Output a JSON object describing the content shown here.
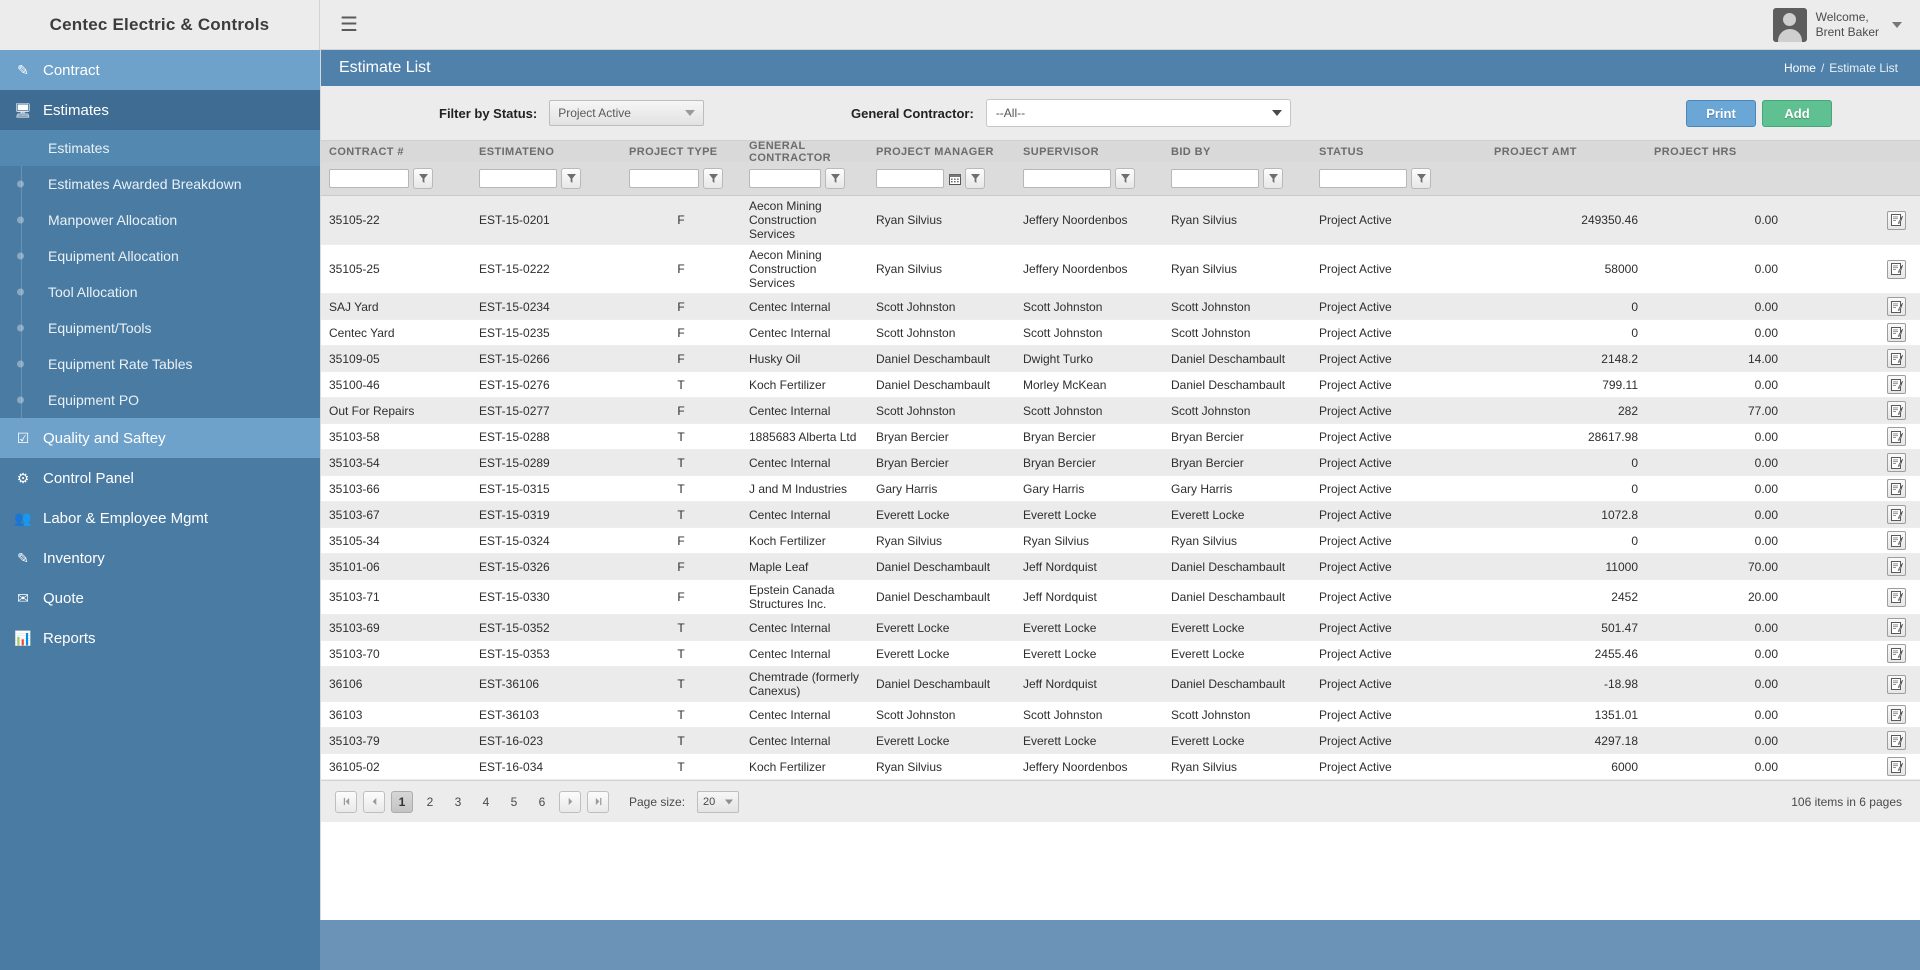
{
  "topbar": {
    "brand": "Centec Electric & Controls",
    "menu_icon": "hamburger-icon",
    "welcome_line1": "Welcome,",
    "welcome_line2": "Brent Baker"
  },
  "sidebar": {
    "items": [
      {
        "label": "Contract",
        "icon": "edit-square-icon",
        "state": "active-light"
      },
      {
        "label": "Estimates",
        "icon": "monitor-icon",
        "state": "active-dark"
      },
      {
        "label": "Quality and Saftey",
        "icon": "check-square-icon",
        "state": "active-light"
      },
      {
        "label": "Control Panel",
        "icon": "gears-icon",
        "state": "plain"
      },
      {
        "label": "Labor & Employee Mgmt",
        "icon": "users-icon",
        "state": "plain"
      },
      {
        "label": "Inventory",
        "icon": "edit-square-icon",
        "state": "plain"
      },
      {
        "label": "Quote",
        "icon": "envelope-icon",
        "state": "plain"
      },
      {
        "label": "Reports",
        "icon": "chart-icon",
        "state": "plain"
      }
    ],
    "estimates_children": [
      {
        "label": "Estimates",
        "selected": true
      },
      {
        "label": "Estimates Awarded Breakdown",
        "selected": false
      },
      {
        "label": "Manpower Allocation",
        "selected": false
      },
      {
        "label": "Equipment Allocation",
        "selected": false
      },
      {
        "label": "Tool Allocation",
        "selected": false
      },
      {
        "label": "Equipment/Tools",
        "selected": false
      },
      {
        "label": "Equipment Rate Tables",
        "selected": false
      },
      {
        "label": "Equipment PO",
        "selected": false
      }
    ]
  },
  "page": {
    "title": "Estimate List",
    "breadcrumb_home": "Home",
    "breadcrumb_sep": "/",
    "breadcrumb_current": "Estimate List"
  },
  "filters": {
    "status_label": "Filter by Status:",
    "status_value": "Project Active",
    "contractor_label": "General Contractor:",
    "contractor_value": "--All--",
    "print_label": "Print",
    "add_label": "Add"
  },
  "table": {
    "columns": [
      "CONTRACT #",
      "ESTIMATENO",
      "PROJECT TYPE",
      "GENERAL CONTRACTOR",
      "PROJECT MANAGER",
      "SUPERVISOR",
      "BID BY",
      "STATUS",
      "PROJECT AMT",
      "PROJECT HRS"
    ],
    "filter_values": [
      "",
      "",
      "",
      "",
      "",
      "",
      "",
      "",
      "",
      ""
    ],
    "rows": [
      {
        "contract": "35105-22",
        "estimateno": "EST-15-0201",
        "type": "F",
        "gc": "Aecon Mining Construction Services",
        "pm": "Ryan Silvius",
        "sup": "Jeffery Noordenbos",
        "bid": "Ryan Silvius",
        "status": "Project Active",
        "amt": "249350.46",
        "hrs": "0.00"
      },
      {
        "contract": "35105-25",
        "estimateno": "EST-15-0222",
        "type": "F",
        "gc": "Aecon Mining Construction Services",
        "pm": "Ryan Silvius",
        "sup": "Jeffery Noordenbos",
        "bid": "Ryan Silvius",
        "status": "Project Active",
        "amt": "58000",
        "hrs": "0.00"
      },
      {
        "contract": "SAJ Yard",
        "estimateno": "EST-15-0234",
        "type": "F",
        "gc": "Centec Internal",
        "pm": "Scott Johnston",
        "sup": "Scott Johnston",
        "bid": "Scott Johnston",
        "status": "Project Active",
        "amt": "0",
        "hrs": "0.00"
      },
      {
        "contract": "Centec Yard",
        "estimateno": "EST-15-0235",
        "type": "F",
        "gc": "Centec Internal",
        "pm": "Scott Johnston",
        "sup": "Scott Johnston",
        "bid": "Scott Johnston",
        "status": "Project Active",
        "amt": "0",
        "hrs": "0.00"
      },
      {
        "contract": "35109-05",
        "estimateno": "EST-15-0266",
        "type": "F",
        "gc": "Husky Oil",
        "pm": "Daniel Deschambault",
        "sup": "Dwight Turko",
        "bid": "Daniel Deschambault",
        "status": "Project Active",
        "amt": "2148.2",
        "hrs": "14.00"
      },
      {
        "contract": "35100-46",
        "estimateno": "EST-15-0276",
        "type": "T",
        "gc": "Koch Fertilizer",
        "pm": "Daniel Deschambault",
        "sup": "Morley McKean",
        "bid": "Daniel Deschambault",
        "status": "Project Active",
        "amt": "799.11",
        "hrs": "0.00"
      },
      {
        "contract": "Out For Repairs",
        "estimateno": "EST-15-0277",
        "type": "F",
        "gc": "Centec Internal",
        "pm": "Scott Johnston",
        "sup": "Scott Johnston",
        "bid": "Scott Johnston",
        "status": "Project Active",
        "amt": "282",
        "hrs": "77.00"
      },
      {
        "contract": "35103-58",
        "estimateno": "EST-15-0288",
        "type": "T",
        "gc": "1885683 Alberta Ltd",
        "pm": "Bryan Bercier",
        "sup": "Bryan Bercier",
        "bid": "Bryan Bercier",
        "status": "Project Active",
        "amt": "28617.98",
        "hrs": "0.00"
      },
      {
        "contract": "35103-54",
        "estimateno": "EST-15-0289",
        "type": "T",
        "gc": "Centec Internal",
        "pm": "Bryan Bercier",
        "sup": "Bryan Bercier",
        "bid": "Bryan Bercier",
        "status": "Project Active",
        "amt": "0",
        "hrs": "0.00"
      },
      {
        "contract": "35103-66",
        "estimateno": "EST-15-0315",
        "type": "T",
        "gc": "J and M Industries",
        "pm": "Gary Harris",
        "sup": "Gary Harris",
        "bid": "Gary Harris",
        "status": "Project Active",
        "amt": "0",
        "hrs": "0.00"
      },
      {
        "contract": "35103-67",
        "estimateno": "EST-15-0319",
        "type": "T",
        "gc": "Centec Internal",
        "pm": "Everett Locke",
        "sup": "Everett Locke",
        "bid": "Everett Locke",
        "status": "Project Active",
        "amt": "1072.8",
        "hrs": "0.00"
      },
      {
        "contract": "35105-34",
        "estimateno": "EST-15-0324",
        "type": "F",
        "gc": "Koch Fertilizer",
        "pm": "Ryan Silvius",
        "sup": "Ryan Silvius",
        "bid": "Ryan Silvius",
        "status": "Project Active",
        "amt": "0",
        "hrs": "0.00"
      },
      {
        "contract": "35101-06",
        "estimateno": "EST-15-0326",
        "type": "F",
        "gc": "Maple Leaf",
        "pm": "Daniel Deschambault",
        "sup": "Jeff Nordquist",
        "bid": "Daniel Deschambault",
        "status": "Project Active",
        "amt": "11000",
        "hrs": "70.00"
      },
      {
        "contract": "35103-71",
        "estimateno": "EST-15-0330",
        "type": "F",
        "gc": "Epstein Canada Structures Inc.",
        "pm": "Daniel Deschambault",
        "sup": "Jeff Nordquist",
        "bid": "Daniel Deschambault",
        "status": "Project Active",
        "amt": "2452",
        "hrs": "20.00"
      },
      {
        "contract": "35103-69",
        "estimateno": "EST-15-0352",
        "type": "T",
        "gc": "Centec Internal",
        "pm": "Everett Locke",
        "sup": "Everett Locke",
        "bid": "Everett Locke",
        "status": "Project Active",
        "amt": "501.47",
        "hrs": "0.00"
      },
      {
        "contract": "35103-70",
        "estimateno": "EST-15-0353",
        "type": "T",
        "gc": "Centec Internal",
        "pm": "Everett Locke",
        "sup": "Everett Locke",
        "bid": "Everett Locke",
        "status": "Project Active",
        "amt": "2455.46",
        "hrs": "0.00"
      },
      {
        "contract": "36106",
        "estimateno": "EST-36106",
        "type": "T",
        "gc": "Chemtrade (formerly Canexus)",
        "pm": "Daniel Deschambault",
        "sup": "Jeff Nordquist",
        "bid": "Daniel Deschambault",
        "status": "Project Active",
        "amt": "-18.98",
        "hrs": "0.00"
      },
      {
        "contract": "36103",
        "estimateno": "EST-36103",
        "type": "T",
        "gc": "Centec Internal",
        "pm": "Scott Johnston",
        "sup": "Scott Johnston",
        "bid": "Scott Johnston",
        "status": "Project Active",
        "amt": "1351.01",
        "hrs": "0.00"
      },
      {
        "contract": "35103-79",
        "estimateno": "EST-16-023",
        "type": "T",
        "gc": "Centec Internal",
        "pm": "Everett Locke",
        "sup": "Everett Locke",
        "bid": "Everett Locke",
        "status": "Project Active",
        "amt": "4297.18",
        "hrs": "0.00"
      },
      {
        "contract": "36105-02",
        "estimateno": "EST-16-034",
        "type": "T",
        "gc": "Koch Fertilizer",
        "pm": "Ryan Silvius",
        "sup": "Jeffery Noordenbos",
        "bid": "Ryan Silvius",
        "status": "Project Active",
        "amt": "6000",
        "hrs": "0.00"
      }
    ]
  },
  "pager": {
    "pages": [
      "1",
      "2",
      "3",
      "4",
      "5",
      "6"
    ],
    "current_page": "1",
    "page_size_label": "Page size:",
    "page_size_value": "20",
    "info": "106 items in 6 pages"
  }
}
